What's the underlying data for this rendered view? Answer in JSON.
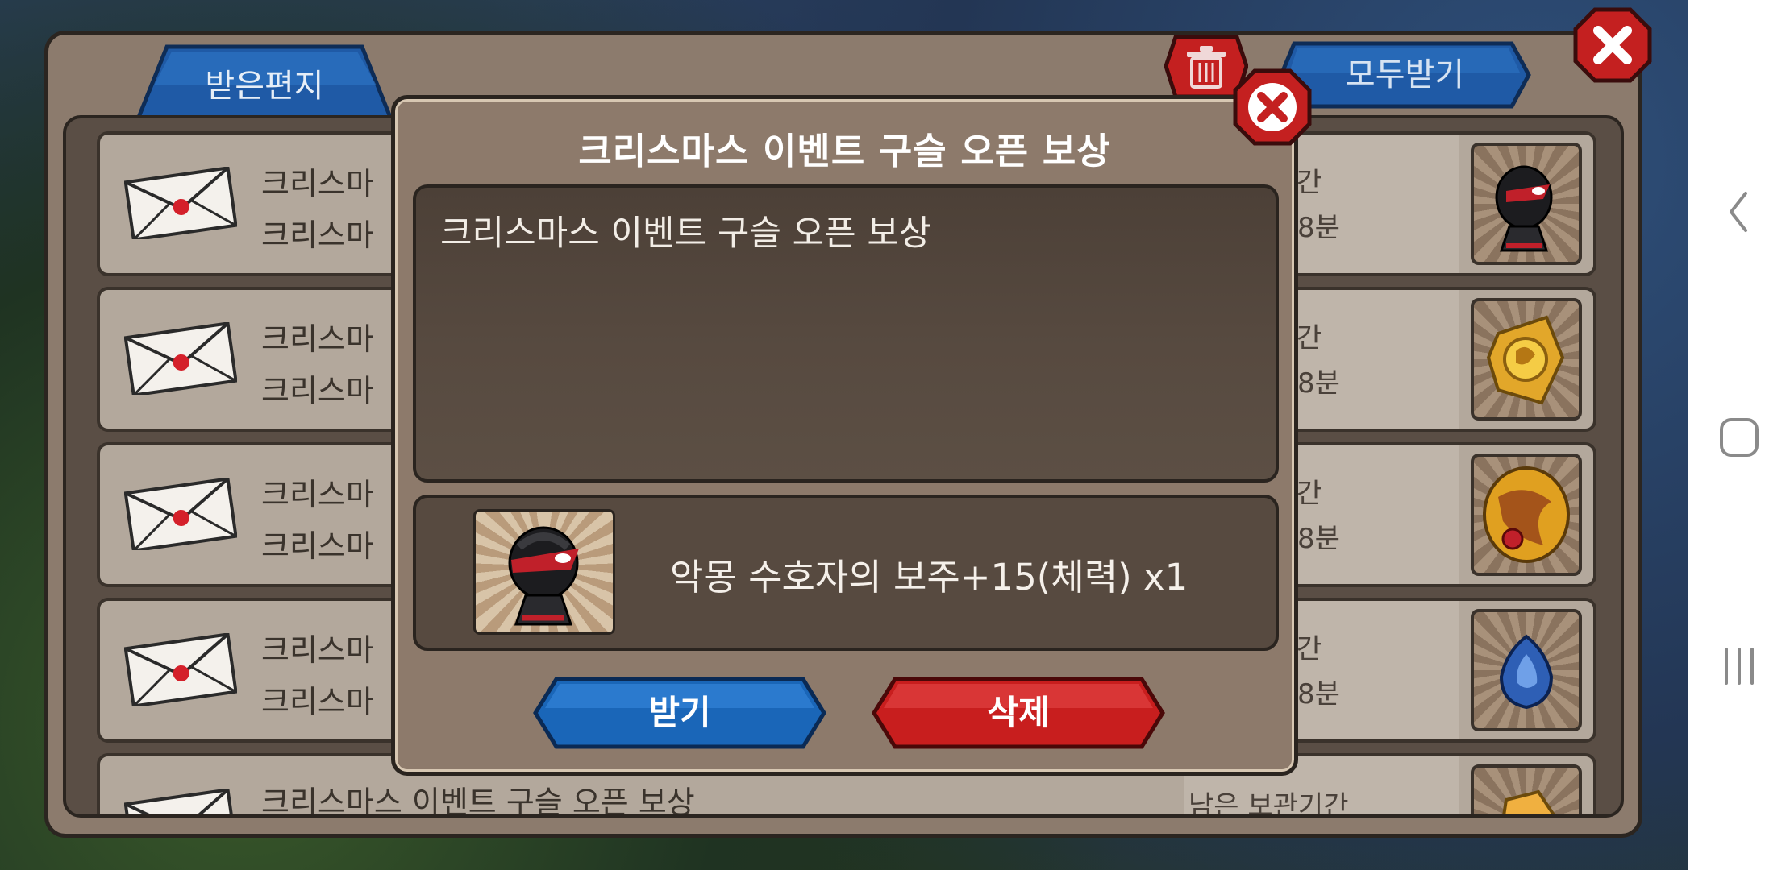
{
  "tabs": {
    "received": "받은편지"
  },
  "toolbar": {
    "claim_all": "모두받기"
  },
  "mail_items": [
    {
      "title": "크리스마",
      "subtitle": "크리스마",
      "expire_label": "보관기간",
      "expire_time": "시간 58분",
      "item_icon": "nightmare-guardian-orb-icon"
    },
    {
      "title": "크리스마",
      "subtitle": "크리스마",
      "expire_label": "보관기간",
      "expire_time": "시간 58분",
      "item_icon": "gold-crest-icon"
    },
    {
      "title": "크리스마",
      "subtitle": "크리스마",
      "expire_label": "보관기간",
      "expire_time": "시간 58분",
      "item_icon": "gold-dragon-egg-icon"
    },
    {
      "title": "크리스마",
      "subtitle": "크리스마",
      "expire_label": "보관기간",
      "expire_time": "시간 58분",
      "item_icon": "blue-flame-icon"
    },
    {
      "title": "크리스마스 이벤트 구슬 오픈 보상",
      "subtitle": "",
      "expire_label": "남은 보관기간",
      "expire_time": "",
      "item_icon": "gold-ore-icon"
    }
  ],
  "dialog": {
    "title": "크리스마스 이벤트 구슬 오픈 보상",
    "message": "크리스마스 이벤트 구슬 오픈 보상",
    "reward_text": "악몽 수호자의 보주+15(체력) x1",
    "receive_label": "받기",
    "delete_label": "삭제"
  },
  "colors": {
    "blue_button": "#1a66b8",
    "red_button": "#c81e1e",
    "panel": "#8c7b6d"
  }
}
